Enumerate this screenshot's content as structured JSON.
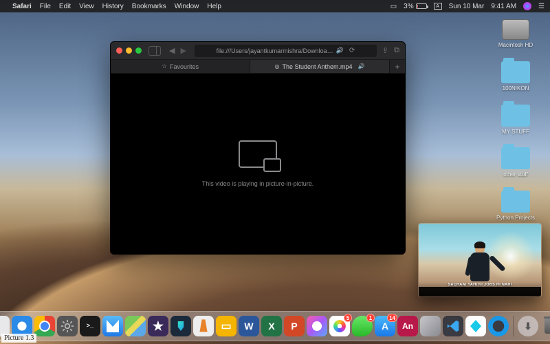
{
  "menubar": {
    "app": "Safari",
    "items": [
      "File",
      "Edit",
      "View",
      "History",
      "Bookmarks",
      "Window",
      "Help"
    ],
    "battery_pct": "3%",
    "date": "Sun 10 Mar",
    "time": "9:41 AM"
  },
  "desktop_icons": [
    {
      "kind": "hd",
      "label": "Macintosh HD"
    },
    {
      "kind": "folder",
      "label": "100NIKON"
    },
    {
      "kind": "folder",
      "label": "MY STUFF"
    },
    {
      "kind": "folder",
      "label": "other stuff"
    },
    {
      "kind": "folder",
      "label": "Python Projects"
    }
  ],
  "safari": {
    "address": "file:///Users/jayantkumarmishra/Downloa…",
    "tabs": [
      {
        "label": "Favourites",
        "active": false,
        "icon": "star"
      },
      {
        "label": "The Student Anthem.mp4",
        "active": true,
        "icon": "doc"
      }
    ],
    "pip_message": "This video is playing in picture-in-picture."
  },
  "pip_video": {
    "subtitle": "SACHAAI YAHI KI JOBS HI NAHI"
  },
  "dock": {
    "apps": [
      {
        "name": "finder",
        "running": true
      },
      {
        "name": "safari",
        "running": true
      },
      {
        "name": "chrome"
      },
      {
        "name": "settings"
      },
      {
        "name": "terminal"
      },
      {
        "name": "mail"
      },
      {
        "name": "maps"
      },
      {
        "name": "imovie"
      },
      {
        "name": "filmora"
      },
      {
        "name": "vlc"
      },
      {
        "name": "slides"
      },
      {
        "name": "word",
        "glyph": "W"
      },
      {
        "name": "excel",
        "glyph": "X"
      },
      {
        "name": "powerpoint",
        "glyph": "P"
      },
      {
        "name": "itunes"
      },
      {
        "name": "photos",
        "badge": "5"
      },
      {
        "name": "messages",
        "badge": "1"
      },
      {
        "name": "appstore",
        "glyph": "A",
        "badge": "14"
      },
      {
        "name": "adobe-an",
        "glyph": "An"
      },
      {
        "name": "cube"
      },
      {
        "name": "vscode"
      },
      {
        "name": "kite"
      },
      {
        "name": "quicktime"
      }
    ]
  },
  "caption": "Picture 1.3"
}
